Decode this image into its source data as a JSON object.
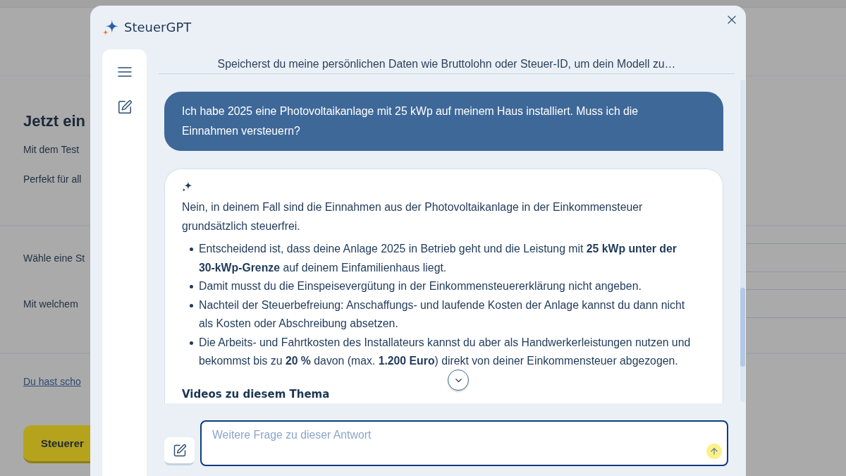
{
  "background_page": {
    "heading": "Jetzt ein",
    "paragraphs": [
      "Mit dem Test",
      "Perfekt für all"
    ],
    "form_labels": [
      "Wähle eine St",
      "Mit welchem"
    ],
    "link": "Du hast scho",
    "button": "Steuerer"
  },
  "dialog": {
    "title": "SteuerGPT",
    "conversation_title": "Speicherst du meine persönlichen Daten wie Bruttolohn oder Steuer-ID, um dein Modell zu…",
    "messages": [
      {
        "kind": "question",
        "text": "Ich habe 2025 eine Photovoltaikanlage mit 25 kWp auf meinem Haus installiert. Muss ich die Einnahmen versteuern?"
      },
      {
        "kind": "answer",
        "text": "Nein, in deinem Fall sind die Einnahmen aus der Photovoltaikanlage in der Einkommensteuer grundsätzlich steuerfrei.",
        "bullets": [
          "Entscheidend ist, dass deine Anlage 2025 in Betrieb geht und die Leistung mit **25 kWp unter der 30-kWp-Grenze** auf deinem Einfamilienhaus liegt.",
          "Damit musst du die Einspeisevergütung in der Einkommensteuererklärung nicht angeben.",
          "Nachteil der Steuerbefreiung: Anschaffungs- und laufende Kosten der Anlage kannst du dann nicht als Kosten oder Abschreibung absetzen.",
          "Die Arbeits- und Fahrtkosten des Installateurs kannst du aber als Handwerkerleistungen nutzen und bekommst bis zu **20 %** davon (max. **1.200 Euro**) direkt von deiner Einkommensteuer abgezogen."
        ],
        "section_heading": "Videos zu diesem Thema"
      }
    ],
    "input": {
      "placeholder": "Weitere Frage zu dieser Antwort"
    }
  }
}
